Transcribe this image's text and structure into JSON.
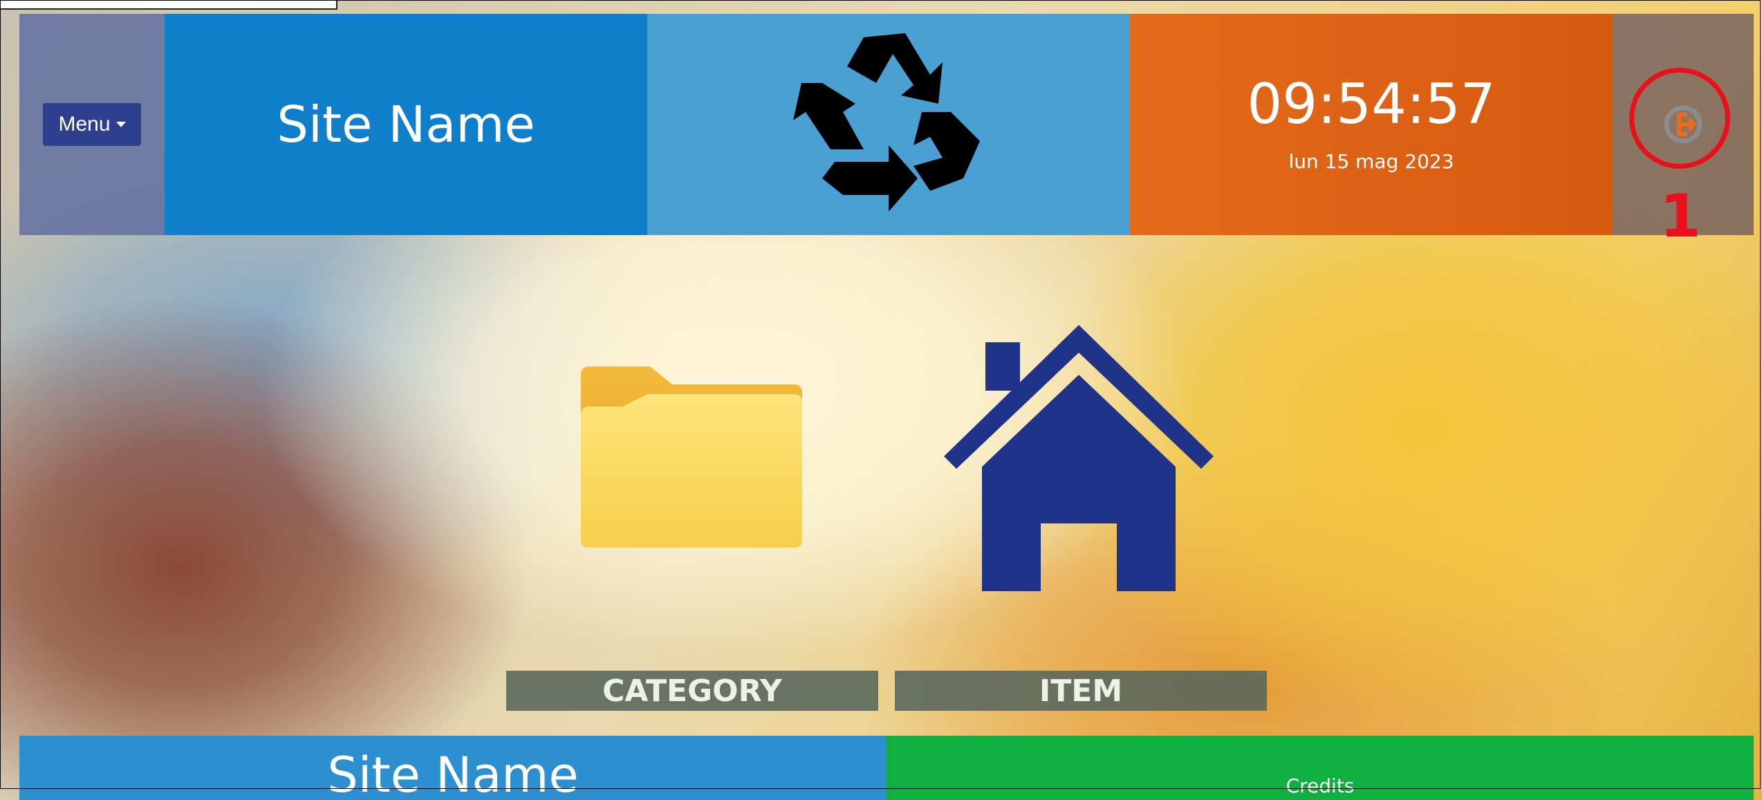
{
  "header": {
    "menu_label": "Menu",
    "site_name": "Site Name",
    "logo_icon": "recycle-icon",
    "clock": {
      "time": "09:54:57",
      "date": "lun 15 mag 2023"
    },
    "user_icon": "exit-icon"
  },
  "annotation": {
    "number": "1",
    "color": "#e8101a"
  },
  "tiles": [
    {
      "label": "CATEGORY",
      "icon": "folder-icon"
    },
    {
      "label": "ITEM",
      "icon": "home-icon"
    }
  ],
  "footer": {
    "site_name": "Site Name",
    "credits": "Credits"
  },
  "colors": {
    "site_tile": "#0f7fcc",
    "logo_tile": "#4aa0d2",
    "clock_tile": "#e46a1a",
    "menu_button": "#2f3f8f",
    "home_icon": "#1f3388",
    "footer_right": "#10b040"
  }
}
